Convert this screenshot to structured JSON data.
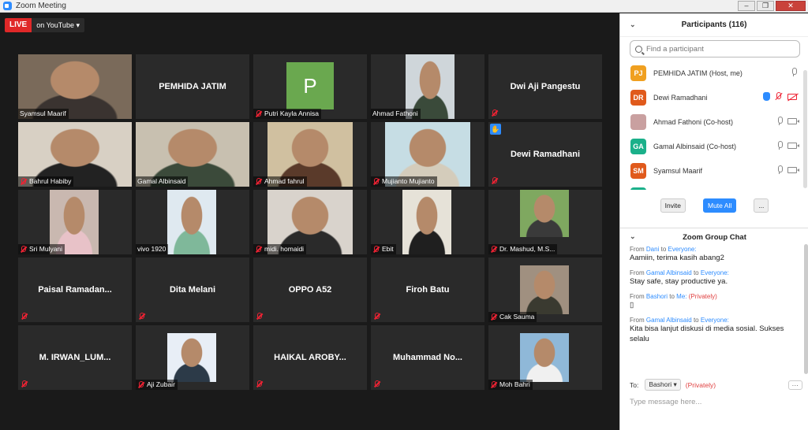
{
  "window": {
    "title": "Zoom Meeting"
  },
  "live": {
    "tag": "LIVE",
    "service": "on YouTube ▾"
  },
  "tiles": [
    {
      "name": "Syamsul Maarif",
      "video": true,
      "muted": false
    },
    {
      "name": "PEMHIDA JATIM",
      "video": false,
      "muted": false
    },
    {
      "name": "Putri Kayla Annisa",
      "video": true,
      "muted": true,
      "avatarLetter": "P"
    },
    {
      "name": "Ahmad Fathoni",
      "video": true,
      "muted": false
    },
    {
      "name": "Dwi Aji Pangestu",
      "video": false,
      "muted": true
    },
    {
      "name": "Bahrul Habiby",
      "video": true,
      "muted": true
    },
    {
      "name": "Gamal Albinsaid",
      "video": true,
      "muted": false,
      "active": true
    },
    {
      "name": "Ahmad fahrul",
      "video": true,
      "muted": true
    },
    {
      "name": "Mujianto Mujianto",
      "video": true,
      "muted": true
    },
    {
      "name": "Dewi Ramadhani",
      "video": false,
      "muted": true,
      "hand": true
    },
    {
      "name": "Sri Mulyani",
      "video": true,
      "muted": true
    },
    {
      "name": "vivo 1920",
      "video": true,
      "muted": false
    },
    {
      "name": "midi. homaidi",
      "video": true,
      "muted": true
    },
    {
      "name": "Ebit",
      "video": true,
      "muted": true
    },
    {
      "name": "Dr. Mashud, M.S...",
      "video": true,
      "muted": true
    },
    {
      "name": "Paisal  Ramadan...",
      "video": false,
      "muted": true
    },
    {
      "name": "Dita Melani",
      "video": false,
      "muted": true
    },
    {
      "name": "OPPO A52",
      "video": false,
      "muted": true
    },
    {
      "name": "Firoh Batu",
      "video": false,
      "muted": true
    },
    {
      "name": "Cak Sauma",
      "video": true,
      "muted": true
    },
    {
      "name": "M. IRWAN_LUM...",
      "video": false,
      "muted": true
    },
    {
      "name": "Aji Zubair",
      "video": true,
      "muted": true
    },
    {
      "name": "HAIKAL  AROBY...",
      "video": false,
      "muted": true
    },
    {
      "name": "Muhammad  No...",
      "video": false,
      "muted": true
    },
    {
      "name": "Moh Bahri",
      "video": true,
      "muted": true
    }
  ],
  "participants": {
    "title": "Participants (116)",
    "search_placeholder": "Find a participant",
    "list": [
      {
        "initials": "PJ",
        "color": "#f0a020",
        "name": "PEMHIDA JATIM (Host, me)",
        "icons": "mic"
      },
      {
        "initials": "DR",
        "color": "#e05a1c",
        "name": "Dewi Ramadhani",
        "icons": "hand-muted"
      },
      {
        "initials": "",
        "color": "#c9a0a0",
        "name": "Ahmad Fathoni (Co-host)",
        "icons": "mic-cam"
      },
      {
        "initials": "GA",
        "color": "#1bb08a",
        "name": "Gamal Albinsaid (Co-host)",
        "icons": "mic-cam"
      },
      {
        "initials": "SM",
        "color": "#e05a1c",
        "name": "Syamsul Maarif",
        "icons": "mic-cam"
      },
      {
        "initials": "",
        "color": "#1bb08a",
        "name": "",
        "icons": ""
      }
    ],
    "buttons": {
      "invite": "Invite",
      "mute_all": "Mute All",
      "more": "..."
    }
  },
  "chat": {
    "title": "Zoom Group Chat",
    "messages": [
      {
        "from_label": "From",
        "sender": "Dani",
        "to_label": "to",
        "recipient": "Everyone:",
        "private": "",
        "text": "Aamiin, terima kasih abang2"
      },
      {
        "from_label": "From",
        "sender": "Gamal Albinsaid",
        "to_label": "to",
        "recipient": "Everyone:",
        "private": "",
        "text": "Stay safe, stay productive ya."
      },
      {
        "from_label": "From",
        "sender": "Bashori",
        "to_label": "to",
        "recipient": "Me:",
        "private": "(Privately)",
        "text": "▯"
      },
      {
        "from_label": "From",
        "sender": "Gamal Albinsaid",
        "to_label": "to",
        "recipient": "Everyone:",
        "private": "",
        "text": "Kita bisa lanjut diskusi di media sosial. Sukses selalu"
      }
    ],
    "to_label": "To:",
    "to_value": "Bashori ▾",
    "to_private": "(Privately)",
    "more": "···",
    "input_placeholder": "Type message here..."
  },
  "colors": {
    "accent": "#2d8cff",
    "live": "#e02828",
    "active_border": "#d8e24b"
  }
}
